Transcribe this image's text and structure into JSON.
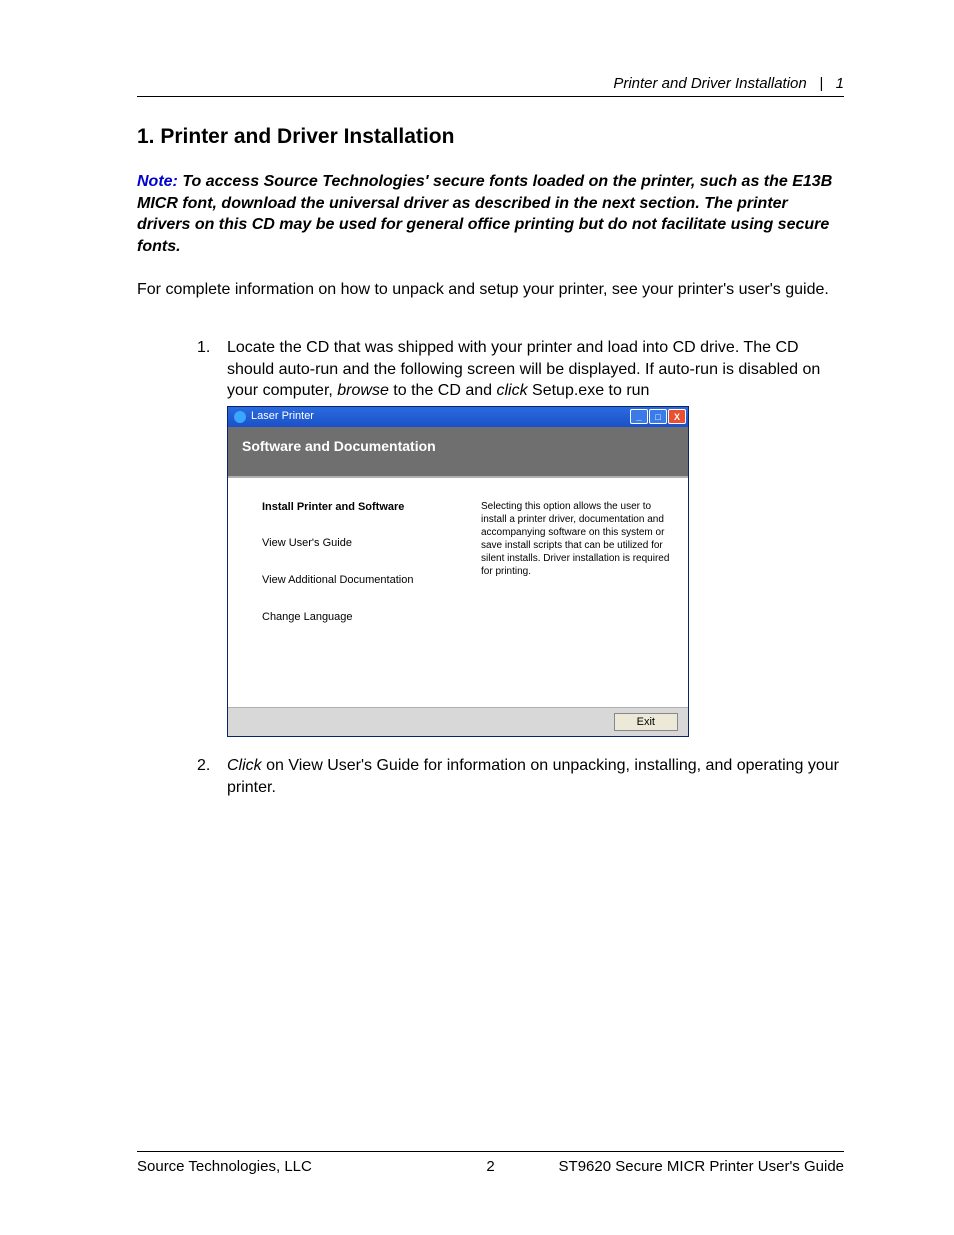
{
  "header": {
    "section_title": "Printer and Driver Installation",
    "section_number": "1"
  },
  "heading": "1.  Printer and Driver Installation",
  "note": {
    "label": "Note:",
    "text": " To access Source Technologies' secure fonts loaded on the printer, such as the E13B MICR font, download the universal driver as described in the next section. The printer drivers on this CD may be used for general office printing but do not facilitate using secure fonts."
  },
  "intro": "For complete information on how to unpack and setup your printer, see your printer's user's guide.",
  "steps": [
    {
      "num": "1.",
      "pre": "Locate the CD that was shipped with your printer and load into CD drive. The CD should auto-run and the following screen will be displayed. If auto-run is disabled on your computer, ",
      "italic1": "browse",
      "mid": " to the CD and ",
      "italic2": "click",
      "post": " Setup.exe to run"
    },
    {
      "num": "2.",
      "italic1": "Click",
      "post": " on View User's Guide for information on unpacking, installing, and operating your printer."
    }
  ],
  "installer": {
    "titlebar": "Laser Printer",
    "header": "Software and Documentation",
    "menu": [
      "Install Printer and Software",
      "View User's Guide",
      "View Additional Documentation",
      "Change Language"
    ],
    "description": "Selecting this option allows the user to install a printer driver, documentation and accompanying software on this system or save install scripts that can be utilized for silent installs. Driver installation is required for printing.",
    "exit": "Exit",
    "winbtns": {
      "min": "_",
      "max": "□",
      "close": "X"
    }
  },
  "footer": {
    "left": "Source Technologies, LLC",
    "center": "2",
    "right": "ST9620 Secure MICR Printer User's Guide"
  }
}
